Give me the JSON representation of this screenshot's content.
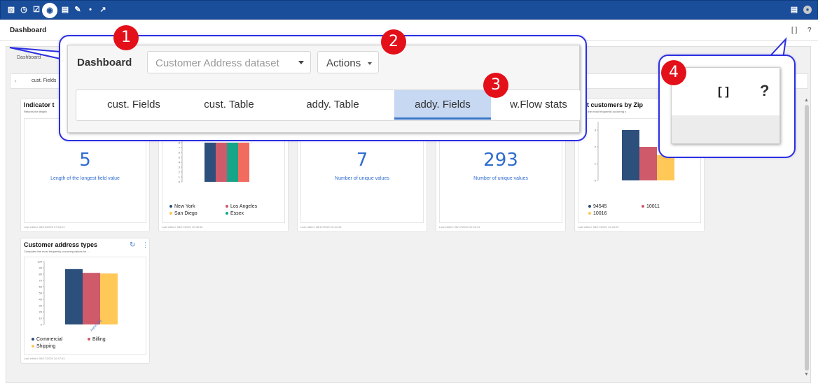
{
  "toolbar": {
    "icons": [
      "database-icon",
      "clock-icon",
      "checkbox-icon",
      "dashboard-icon",
      "document-icon",
      "edit-document-icon",
      "pin-icon",
      "wrench-icon"
    ],
    "right_icons": [
      "list-icon",
      "user-avatar-icon"
    ]
  },
  "header": {
    "title": "Dashboard",
    "expand_glyph": "[ ]",
    "help_glyph": "?"
  },
  "breadcrumb": "Dashboard",
  "tabstrip": {
    "first_tab": "cust. Fields"
  },
  "cards": [
    {
      "id": "indicator",
      "title": "Indicator t",
      "subtitle": "Returns the length",
      "value": "5",
      "caption": "Length of the longest field value",
      "footer": "Last edited: 08/19/2020 07:54:24"
    },
    {
      "id": "cities",
      "footer": "Last edited: 08/17/2020 10:36:56",
      "legend": [
        "New York",
        "Los Angeles",
        "San Diego",
        "Essex"
      ]
    },
    {
      "id": "unique1",
      "value": "7",
      "caption": "Number of unique values",
      "footer": "Last edited: 08/17/2020 10:44:15"
    },
    {
      "id": "unique2",
      "value": "293",
      "caption": "Number of unique values",
      "footer": "Last edited: 08/17/2020 10:42:31"
    },
    {
      "id": "zip",
      "title": "st customers by Zip",
      "subtitle": "ms the most frequently occurring v",
      "footer": "Last edited: 08/17/2020 10:45:20",
      "legend": [
        "94545",
        "10011",
        "10016"
      ]
    },
    {
      "id": "addrtypes",
      "title": "Customer address types",
      "subtitle": "Computes the most frequently occurring values for ...",
      "footer": "Last edited: 08/17/2020 10:47:43",
      "legend": [
        "Commercial",
        "Billing",
        "Shipping"
      ],
      "x_tick": "ADDRTYPE"
    }
  ],
  "charts": {
    "cities": {
      "type": "bar",
      "values": [
        11,
        11,
        11,
        9
      ],
      "ylim": [
        0,
        12
      ],
      "ticks": [
        "0",
        "1",
        "2",
        "3",
        "4",
        "5",
        "6",
        "7",
        "8"
      ]
    },
    "zip": {
      "type": "bar",
      "values": [
        3,
        2,
        1.5
      ],
      "ylim": [
        0,
        3.5
      ],
      "ticks": [
        "0",
        "1",
        "2",
        "3"
      ]
    },
    "addrtypes": {
      "type": "bar",
      "values": [
        88,
        82,
        81
      ],
      "ylim": [
        0,
        100
      ],
      "ticks": [
        "0",
        "10",
        "20",
        "30",
        "40",
        "50",
        "60",
        "70",
        "80",
        "90",
        "100"
      ]
    }
  },
  "colors": {
    "navy": "#2c4f7c",
    "red": "#cf5a6a",
    "yellow": "#ffc857",
    "teal": "#17a589",
    "coral": "#f26b5f"
  },
  "callouts": {
    "one": "1",
    "two": "2",
    "three": "3",
    "four": "4",
    "panel_title": "Dashboard",
    "dataset_select": "Customer Address dataset",
    "actions_button": "Actions",
    "tabs": [
      "cust. Fields",
      "cust. Table",
      "addy. Table",
      "addy. Fields",
      "w.Flow stats"
    ],
    "selected_tab": "addy. Fields",
    "expand_glyph": "[ ]",
    "help_glyph": "?"
  }
}
